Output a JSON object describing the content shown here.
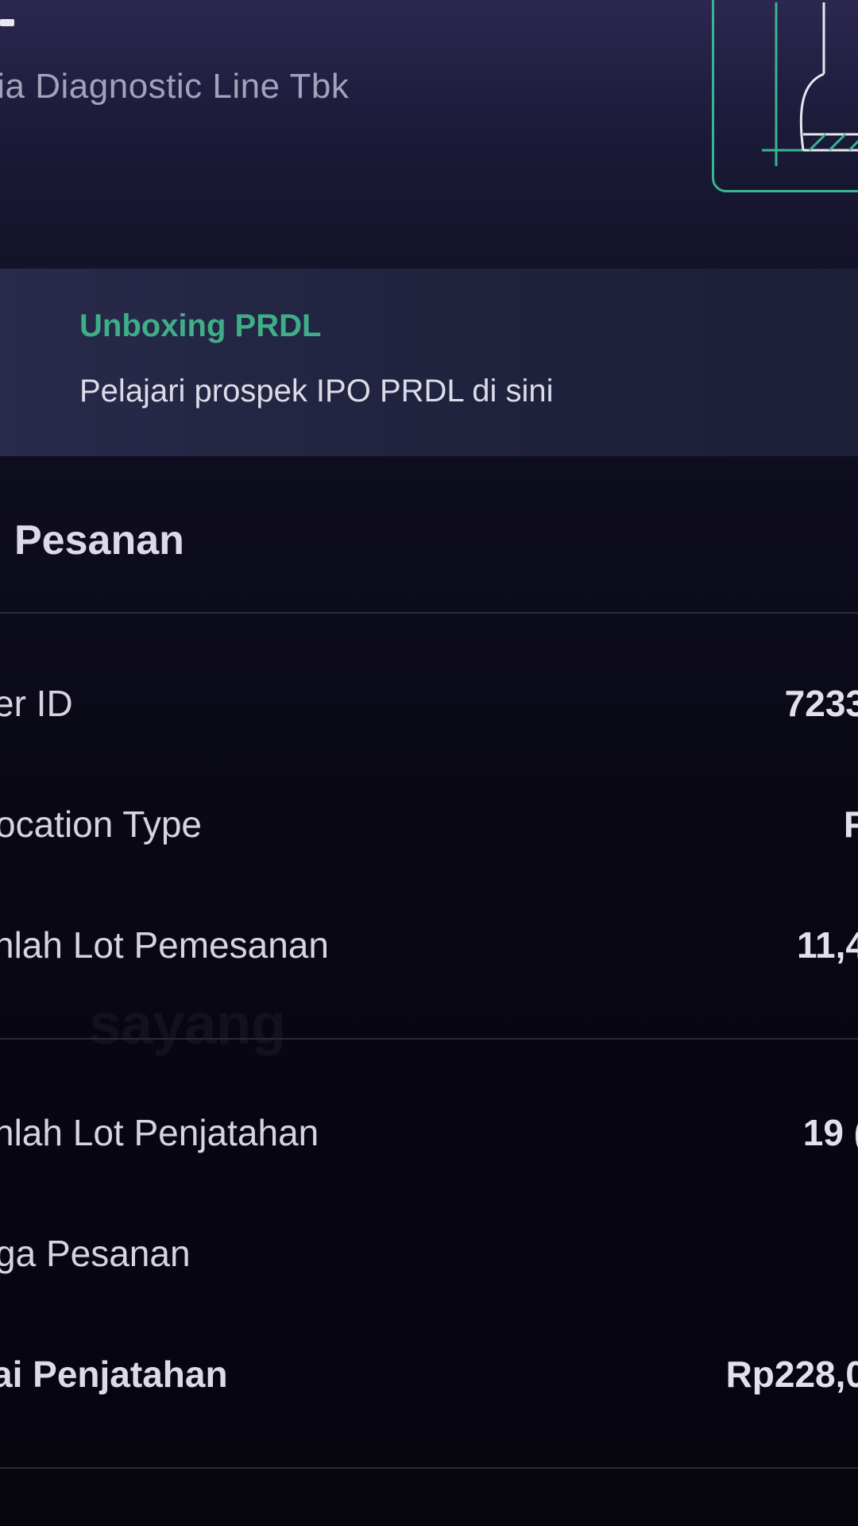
{
  "header": {
    "company_name": "lia Diagnostic Line Tbk"
  },
  "promo": {
    "title": "Unboxing PRDL",
    "subtitle": "Pelajari prospek IPO PRDL di sini"
  },
  "order": {
    "section_title": "Pesanan",
    "rows": [
      {
        "label": "er ID",
        "value": "7233"
      },
      {
        "label": "ocation Type",
        "value": "F"
      },
      {
        "label": "nlah Lot Pemesanan",
        "value": "11,4"
      },
      {
        "label": "nlah Lot Penjatahan",
        "value": "19 ("
      },
      {
        "label": "ga Pesanan",
        "value": ""
      },
      {
        "label": "ai Penjatahan",
        "value": "Rp228,0"
      }
    ]
  },
  "watermark": {
    "text": "sayang"
  },
  "colors": {
    "accent_green": "#3fae88",
    "background": "#080712",
    "header_purple": "#2b2750"
  },
  "icons": {
    "illustration": "document-chart-icon"
  }
}
